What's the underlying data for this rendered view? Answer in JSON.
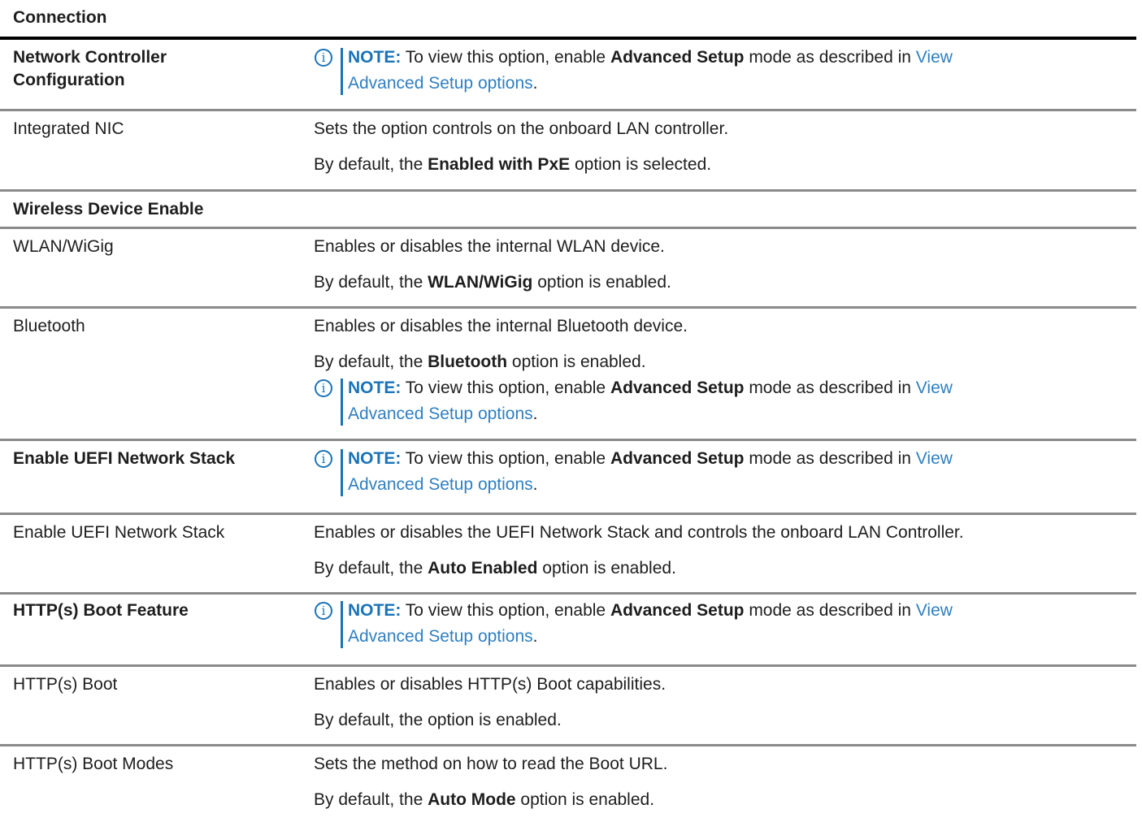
{
  "header": {
    "title": "Connection"
  },
  "note": {
    "label": "NOTE:",
    "text_before": " To view this option, enable ",
    "bold": "Advanced Setup",
    "text_after": " mode as described in ",
    "link_line1": "View",
    "link_line2": "Advanced Setup options",
    "end": "."
  },
  "rows": {
    "network_controller": {
      "label_line1": "Network Controller",
      "label_line2": "Configuration"
    },
    "integrated_nic": {
      "label": "Integrated NIC",
      "desc": "Sets the option controls on the onboard LAN controller.",
      "default_prefix": "By default, the ",
      "default_bold": "Enabled with PxE",
      "default_suffix": " option is selected."
    },
    "wireless_device_enable": {
      "label": "Wireless Device Enable"
    },
    "wlan": {
      "label": "WLAN/WiGig",
      "desc": "Enables or disables the internal WLAN device.",
      "default_prefix": "By default, the ",
      "default_bold": "WLAN/WiGig",
      "default_suffix": " option is enabled."
    },
    "bluetooth": {
      "label": "Bluetooth",
      "desc": "Enables or disables the internal Bluetooth device.",
      "default_prefix": "By default, the ",
      "default_bold": "Bluetooth",
      "default_suffix": " option is enabled."
    },
    "uefi_header": {
      "label": "Enable UEFI Network Stack"
    },
    "uefi": {
      "label": "Enable UEFI Network Stack",
      "desc": "Enables or disables the UEFI Network Stack and controls the onboard LAN Controller.",
      "default_prefix": "By default, the ",
      "default_bold": "Auto Enabled",
      "default_suffix": " option is enabled."
    },
    "http_header": {
      "label": "HTTP(s) Boot Feature"
    },
    "http_boot": {
      "label": "HTTP(s) Boot",
      "desc": "Enables or disables HTTP(s) Boot capabilities.",
      "default_text": "By default, the option is enabled."
    },
    "http_modes": {
      "label": "HTTP(s) Boot Modes",
      "desc": "Sets the method on how to read the Boot URL.",
      "default_prefix": "By default, the ",
      "default_bold": "Auto Mode",
      "default_suffix": " option is enabled."
    }
  },
  "colors": {
    "accent": "#1a73b8",
    "link": "#2e7fc2",
    "rule": "#8a8a8a"
  },
  "icons": {
    "note": "info-circle-icon",
    "note_glyph": "i"
  }
}
